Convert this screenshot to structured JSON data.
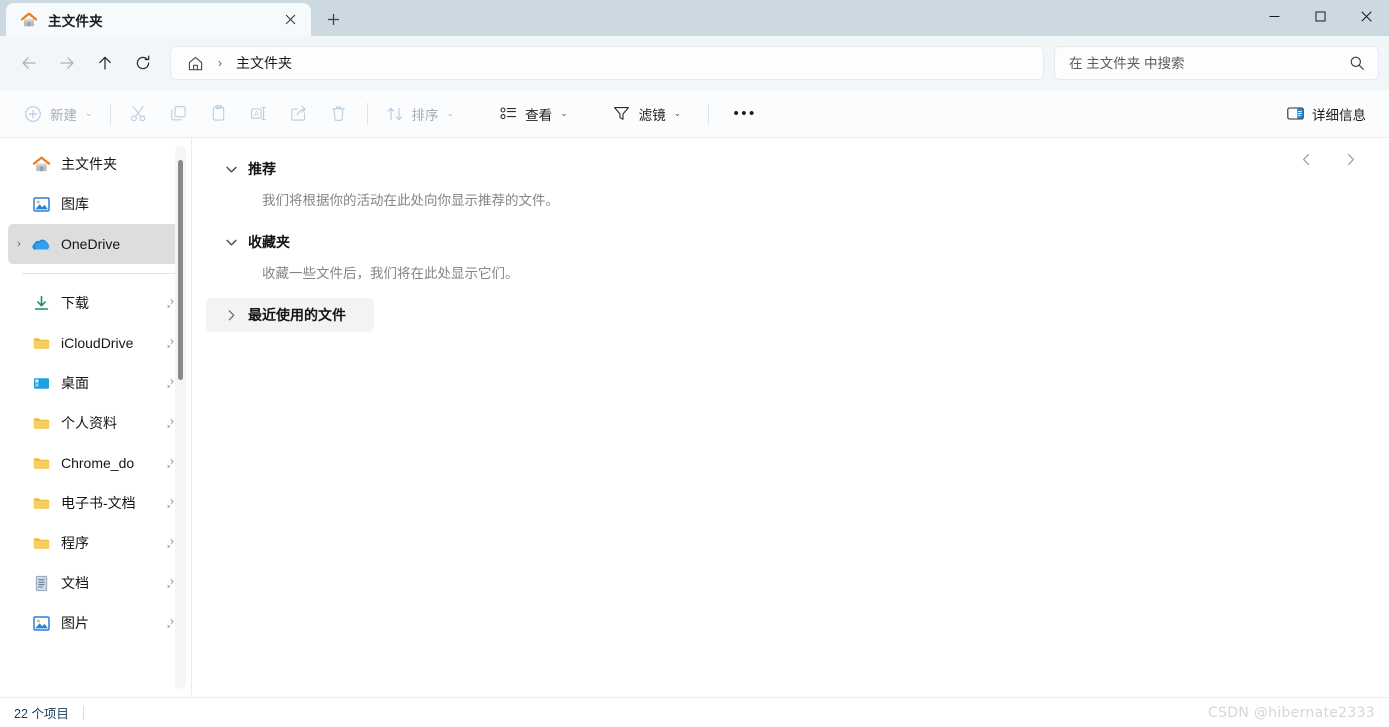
{
  "window": {
    "tab": {
      "title": "主文件夹",
      "icon": "home-folder-icon",
      "close_label": "✕"
    },
    "new_tab_label": "＋",
    "controls": {
      "minimize": "—",
      "maximize": "▢",
      "close": "✕"
    }
  },
  "address": {
    "home_icon": "home-icon",
    "separator": "›",
    "crumb": "主文件夹"
  },
  "search": {
    "placeholder": "在 主文件夹 中搜索",
    "value": "",
    "icon": "search-icon"
  },
  "nav": {
    "back": {
      "label": "←",
      "enabled": false
    },
    "forward": {
      "label": "→",
      "enabled": false
    },
    "up": {
      "label": "↑",
      "enabled": true
    },
    "refresh": {
      "label": "⟳",
      "enabled": true
    }
  },
  "toolbar": {
    "new_label": "新建",
    "cut_label": "剪切",
    "copy_label": "复制",
    "paste_label": "粘贴",
    "rename_label": "重命名",
    "share_label": "共享",
    "delete_label": "删除",
    "sort_label": "排序",
    "view_label": "查看",
    "filter_label": "滤镜",
    "more_label": "•••",
    "details_label": "详细信息",
    "chevron": "⌄"
  },
  "sidebar": {
    "items": [
      {
        "label": "主文件夹",
        "icon": "home-folder-icon",
        "chevron": "",
        "pinned": false,
        "selected": false
      },
      {
        "label": "图库",
        "icon": "gallery-icon",
        "chevron": "",
        "pinned": false,
        "selected": false
      },
      {
        "label": "OneDrive",
        "icon": "onedrive-icon",
        "chevron": "›",
        "pinned": false,
        "selected": true
      }
    ],
    "quick_access": [
      {
        "label": "下载",
        "icon": "download-icon",
        "pinned": true
      },
      {
        "label": "iCloudDrive",
        "icon": "folder-icon",
        "pinned": true
      },
      {
        "label": "桌面",
        "icon": "desktop-icon",
        "pinned": true
      },
      {
        "label": "个人资料",
        "icon": "folder-icon",
        "pinned": true
      },
      {
        "label": "Chrome_do",
        "icon": "folder-icon",
        "pinned": true
      },
      {
        "label": "电子书-文档",
        "icon": "folder-icon",
        "pinned": true
      },
      {
        "label": "程序",
        "icon": "folder-icon",
        "pinned": true
      },
      {
        "label": "文档",
        "icon": "documents-icon",
        "pinned": true
      },
      {
        "label": "图片",
        "icon": "pictures-icon",
        "pinned": true
      }
    ]
  },
  "main": {
    "sections": [
      {
        "title": "推荐",
        "chevron": "expanded",
        "description": "我们将根据你的活动在此处向你显示推荐的文件。",
        "hovered": false
      },
      {
        "title": "收藏夹",
        "chevron": "expanded",
        "description": "收藏一些文件后，我们将在此处显示它们。",
        "hovered": false
      },
      {
        "title": "最近使用的文件",
        "chevron": "collapsed",
        "description": "",
        "hovered": true
      }
    ],
    "pager": {
      "prev": "‹",
      "next": "›"
    }
  },
  "status": {
    "item_count": "22 个项目",
    "watermark": "CSDN @hibernate2333"
  },
  "colors": {
    "titlebar": "#cdd9e0",
    "tab_active": "#f7fafc",
    "accent_blue": "#0078d4",
    "folder_yellow": "#f7c04a",
    "selected_nav": "#dddddd",
    "status_text": "#1b3a5c"
  }
}
